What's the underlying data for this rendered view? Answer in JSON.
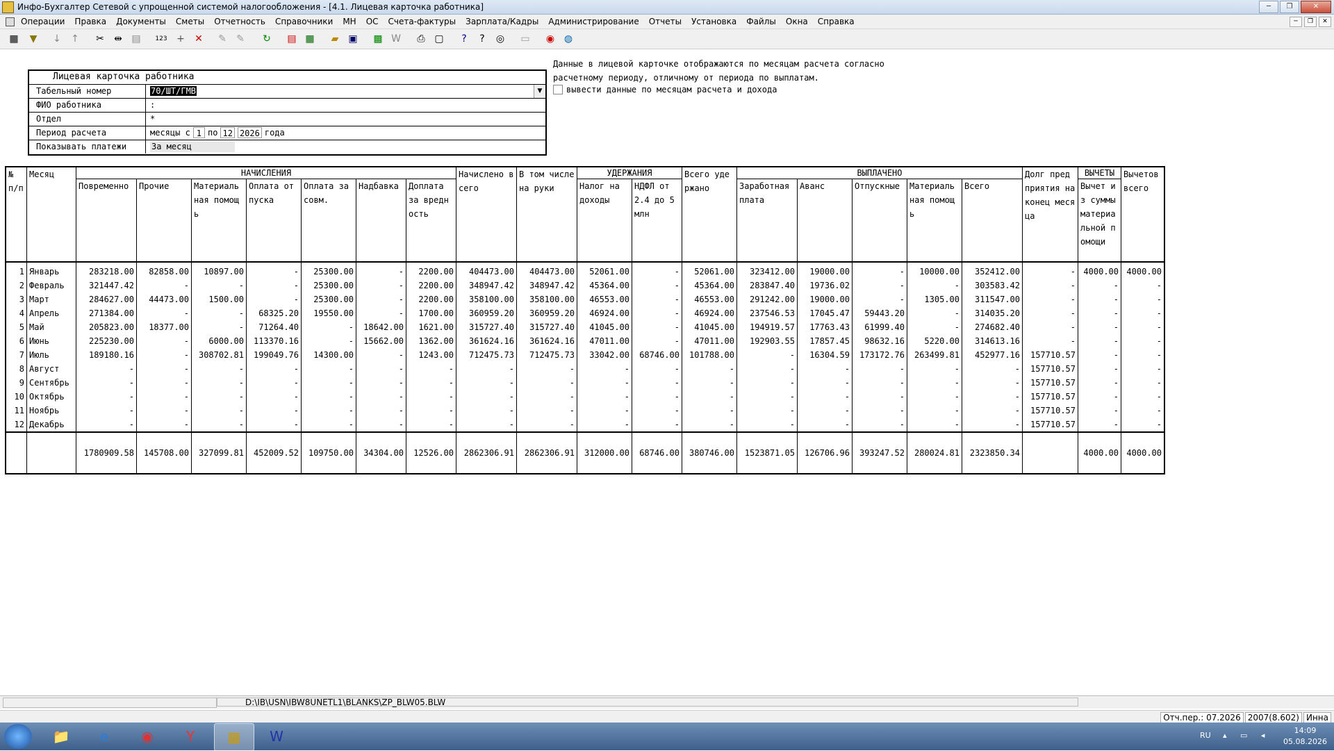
{
  "window": {
    "title": "Инфо-Бухгалтер Сетевой с упрощенной системой налогообложения - [4.1. Лицевая карточка работника]",
    "buttons": [
      "─",
      "❐",
      "✕"
    ]
  },
  "menu": [
    "Операции",
    "Правка",
    "Документы",
    "Сметы",
    "Отчетность",
    "Справочники",
    "МН",
    "ОС",
    "Счета-фактуры",
    "Зарплата/Кадры",
    "Администрирование",
    "Отчеты",
    "Установка",
    "Файлы",
    "Окна",
    "Справка"
  ],
  "form": {
    "title": "Лицевая карточка работника",
    "tab_label": "Табельный номер",
    "tab_value": "70/ШТ/ГМВ",
    "fio_label": "ФИО работника",
    "fio_value": ":",
    "dept_label": "Отдел",
    "dept_value": "*",
    "period_label": "Период расчета",
    "period_text1": "месяцы  с",
    "period_from": "1",
    "period_mid": "по",
    "period_to": "12",
    "period_year": "2026",
    "period_text2": "года",
    "pay_label": "Показывать платежи",
    "pay_value": "За месяц"
  },
  "note": {
    "line1": "Данные в лицевой карточке отображаются по месяцам расчета согласно",
    "line2": "расчетному периоду, отличному от периода по выплатам.",
    "checkbox_label": "вывести данные по месяцам расчета и дохода"
  },
  "table": {
    "groups": {
      "no": "№ п/п",
      "month": "Месяц",
      "accruals": "НАЧИСЛЕНИЯ",
      "accrued_total": "Начислено всего",
      "net": "В том числе на руки",
      "withholdings": "УДЕРЖАНИЯ",
      "withheld_total": "Всего удержано",
      "paid": "ВЫПЛАЧЕНО",
      "debt": "Долг пред приятия на конец месяца",
      "deductions": "ВЫЧЕТЫ",
      "deductions_total": "Вычетов всего"
    },
    "sub": {
      "accruals": [
        "Повременно",
        "Прочие",
        "Материаль ная помощь",
        "Оплата отпуска",
        "Оплата за совм.",
        "Надбавка",
        "Доплата за вредн ость"
      ],
      "withholdings": [
        "Налог на доходы",
        "НДФЛ от 2.4 до 5 млн"
      ],
      "paid": [
        "Заработная плата",
        "Аванс",
        "Отпускные",
        "Материаль ная помощь",
        "Всего"
      ],
      "deductions": [
        "Вычет из суммы материа льной помощи"
      ]
    },
    "rows": [
      [
        "1",
        "Январь",
        "283218.00",
        "82858.00",
        "10897.00",
        "-",
        "25300.00",
        "-",
        "2200.00",
        "404473.00",
        "404473.00",
        "52061.00",
        "-",
        "52061.00",
        "323412.00",
        "19000.00",
        "-",
        "10000.00",
        "352412.00",
        "-",
        "4000.00",
        "4000.00"
      ],
      [
        "2",
        "Февраль",
        "321447.42",
        "-",
        "-",
        "-",
        "25300.00",
        "-",
        "2200.00",
        "348947.42",
        "348947.42",
        "45364.00",
        "-",
        "45364.00",
        "283847.40",
        "19736.02",
        "-",
        "-",
        "303583.42",
        "-",
        "-",
        "-"
      ],
      [
        "3",
        "Март",
        "284627.00",
        "44473.00",
        "1500.00",
        "-",
        "25300.00",
        "-",
        "2200.00",
        "358100.00",
        "358100.00",
        "46553.00",
        "-",
        "46553.00",
        "291242.00",
        "19000.00",
        "-",
        "1305.00",
        "311547.00",
        "-",
        "-",
        "-"
      ],
      [
        "4",
        "Апрель",
        "271384.00",
        "-",
        "-",
        "68325.20",
        "19550.00",
        "-",
        "1700.00",
        "360959.20",
        "360959.20",
        "46924.00",
        "-",
        "46924.00",
        "237546.53",
        "17045.47",
        "59443.20",
        "-",
        "314035.20",
        "-",
        "-",
        "-"
      ],
      [
        "5",
        "Май",
        "205823.00",
        "18377.00",
        "-",
        "71264.40",
        "-",
        "18642.00",
        "1621.00",
        "315727.40",
        "315727.40",
        "41045.00",
        "-",
        "41045.00",
        "194919.57",
        "17763.43",
        "61999.40",
        "-",
        "274682.40",
        "-",
        "-",
        "-"
      ],
      [
        "6",
        "Июнь",
        "225230.00",
        "-",
        "6000.00",
        "113370.16",
        "-",
        "15662.00",
        "1362.00",
        "361624.16",
        "361624.16",
        "47011.00",
        "-",
        "47011.00",
        "192903.55",
        "17857.45",
        "98632.16",
        "5220.00",
        "314613.16",
        "-",
        "-",
        "-"
      ],
      [
        "7",
        "Июль",
        "189180.16",
        "-",
        "308702.81",
        "199049.76",
        "14300.00",
        "-",
        "1243.00",
        "712475.73",
        "712475.73",
        "33042.00",
        "68746.00",
        "101788.00",
        "-",
        "16304.59",
        "173172.76",
        "263499.81",
        "452977.16",
        "157710.57",
        "-",
        "-"
      ],
      [
        "8",
        "Август",
        "-",
        "-",
        "-",
        "-",
        "-",
        "-",
        "-",
        "-",
        "-",
        "-",
        "-",
        "-",
        "-",
        "-",
        "-",
        "-",
        "-",
        "157710.57",
        "-",
        "-"
      ],
      [
        "9",
        "Сентябрь",
        "-",
        "-",
        "-",
        "-",
        "-",
        "-",
        "-",
        "-",
        "-",
        "-",
        "-",
        "-",
        "-",
        "-",
        "-",
        "-",
        "-",
        "157710.57",
        "-",
        "-"
      ],
      [
        "10",
        "Октябрь",
        "-",
        "-",
        "-",
        "-",
        "-",
        "-",
        "-",
        "-",
        "-",
        "-",
        "-",
        "-",
        "-",
        "-",
        "-",
        "-",
        "-",
        "157710.57",
        "-",
        "-"
      ],
      [
        "11",
        "Ноябрь",
        "-",
        "-",
        "-",
        "-",
        "-",
        "-",
        "-",
        "-",
        "-",
        "-",
        "-",
        "-",
        "-",
        "-",
        "-",
        "-",
        "-",
        "157710.57",
        "-",
        "-"
      ],
      [
        "12",
        "Декабрь",
        "-",
        "-",
        "-",
        "-",
        "-",
        "-",
        "-",
        "-",
        "-",
        "-",
        "-",
        "-",
        "-",
        "-",
        "-",
        "-",
        "-",
        "157710.57",
        "-",
        "-"
      ]
    ],
    "totals": [
      "",
      "",
      "1780909.58",
      "145708.00",
      "327099.81",
      "452009.52",
      "109750.00",
      "34304.00",
      "12526.00",
      "2862306.91",
      "2862306.91",
      "312000.00",
      "68746.00",
      "380746.00",
      "1523871.05",
      "126706.96",
      "393247.52",
      "280024.81",
      "2323850.34",
      "",
      "4000.00",
      "4000.00"
    ]
  },
  "path": "D:\\IB\\USN\\IBW8UNETL1\\BLANKS\\ZP_BLW05.BLW",
  "status": [
    "Отч.пер.: 07.2026",
    "2007(8.602)",
    "Инна"
  ],
  "taskbar": {
    "lang": "RU",
    "time": "14:09",
    "date": "05.08.2026"
  }
}
